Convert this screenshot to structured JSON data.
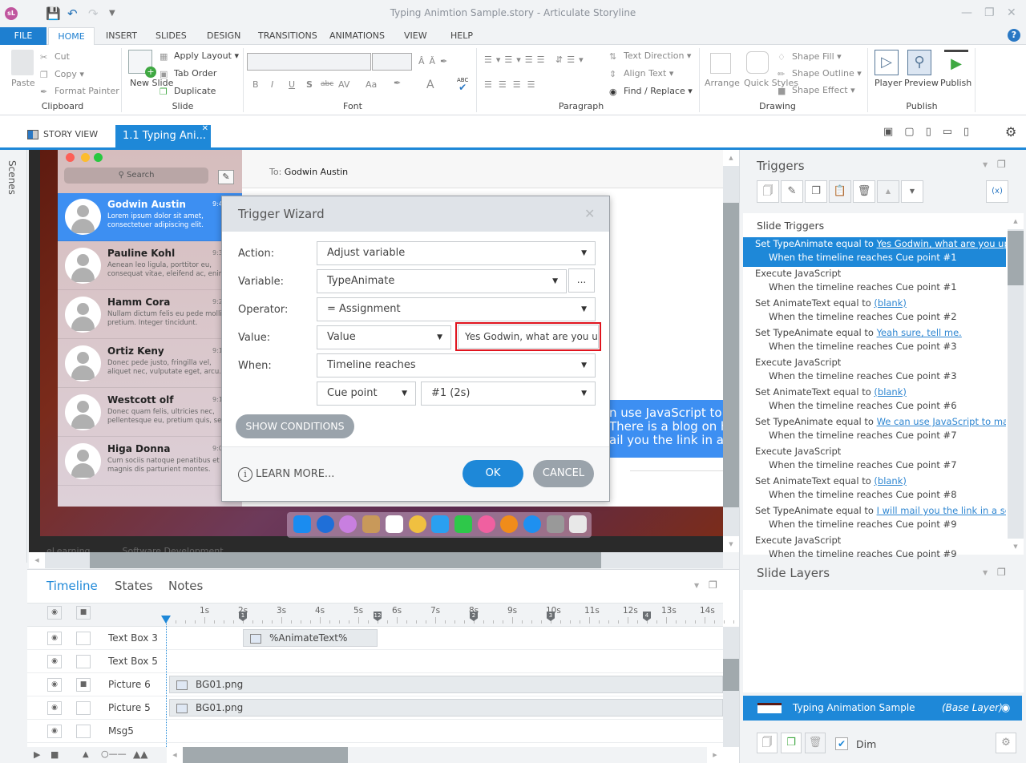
{
  "app": {
    "title": "Typing Animtion Sample.story - Articulate Storyline",
    "logo": "sL"
  },
  "menu": {
    "file": "FILE",
    "tabs": [
      "HOME",
      "INSERT",
      "SLIDES",
      "DESIGN",
      "TRANSITIONS",
      "ANIMATIONS",
      "VIEW",
      "HELP"
    ],
    "active": "HOME"
  },
  "ribbon": {
    "clipboard": {
      "label": "Clipboard",
      "paste": "Paste",
      "cut": "Cut",
      "copy": "Copy",
      "format_painter": "Format Painter"
    },
    "slide": {
      "label": "Slide",
      "new_slide": "New Slide",
      "apply_layout": "Apply Layout",
      "tab_order": "Tab Order",
      "duplicate": "Duplicate"
    },
    "font": {
      "label": "Font",
      "bold": "B",
      "italic": "I",
      "underline": "U",
      "shadow": "S",
      "strike": "abc",
      "spacing": "AV",
      "case": "Aa",
      "color": "A",
      "spell": "ABC"
    },
    "paragraph": {
      "label": "Paragraph",
      "text_direction": "Text Direction",
      "align_text": "Align Text",
      "find_replace": "Find / Replace"
    },
    "drawing": {
      "label": "Drawing",
      "arrange": "Arrange",
      "quick_styles": "Quick Styles",
      "shape_fill": "Shape Fill",
      "shape_outline": "Shape Outline",
      "shape_effect": "Shape Effect"
    },
    "publish": {
      "label": "Publish",
      "player": "Player",
      "preview": "Preview",
      "publish": "Publish"
    }
  },
  "tabs": {
    "story_view": "STORY VIEW",
    "slide_tab": "1.1 Typing Ani..."
  },
  "scenes": "Scenes",
  "slide": {
    "search": "Search",
    "to_label": "To:",
    "to_name": "Godwin Austin",
    "contacts": [
      {
        "name": "Godwin Austin",
        "preview": "Lorem ipsum dolor sit amet, consectetuer adipiscing elit.",
        "time": "9:4"
      },
      {
        "name": "Pauline Kohl",
        "preview": "Aenean leo ligula, porttitor eu, consequat vitae, eleifend ac, enim.",
        "time": "9:3"
      },
      {
        "name": "Hamm Cora",
        "preview": "Nullam dictum felis eu pede mollis pretium. Integer tincidunt.",
        "time": "9:2"
      },
      {
        "name": "Ortiz Keny",
        "preview": "Donec pede justo, fringilla vel, aliquet nec, vulputate eget, arcu.",
        "time": "9:1"
      },
      {
        "name": "Westcott olf",
        "preview": "Donec quam felis, ultricies nec, pellentesque eu, pretium quis, sem.",
        "time": "9:1"
      },
      {
        "name": "Higa Donna",
        "preview": "Cum sociis natoque penatibus et magnis dis parturient montes.",
        "time": "9:0"
      }
    ],
    "bubble_lines": [
      "n use JavaScript to m",
      "There is a blog on h",
      "ail you the link in a s"
    ],
    "footer_text": [
      "eLearning",
      "Software Development"
    ]
  },
  "dialog": {
    "title": "Trigger Wizard",
    "action_label": "Action:",
    "action": "Adjust variable",
    "variable_label": "Variable:",
    "variable": "TypeAnimate",
    "more": "...",
    "operator_label": "Operator:",
    "operator": "= Assignment",
    "value_label": "Value:",
    "value_type": "Value",
    "value_text": "Yes Godwin, what are you upto?",
    "when_label": "When:",
    "when": "Timeline reaches",
    "cue_type": "Cue point",
    "cue": "#1 (2s)",
    "show_conditions": "SHOW CONDITIONS",
    "learn_more": "LEARN MORE...",
    "ok": "OK",
    "cancel": "CANCEL"
  },
  "triggers": {
    "title": "Triggers",
    "section": "Slide Triggers",
    "items": [
      {
        "action": "Set TypeAnimate equal to ",
        "link": "Yes Godwin, what are you upto?",
        "when": "When the timeline reaches Cue point #1",
        "selected": true
      },
      {
        "action": "Execute JavaScript",
        "link": "",
        "when": "When the timeline reaches Cue point #1"
      },
      {
        "action": "Set AnimateText equal to ",
        "link": "(blank)",
        "when": "When the timeline reaches Cue point #2"
      },
      {
        "action": "Set TypeAnimate equal to ",
        "link": "Yeah sure, tell me.",
        "when": "When the timeline reaches Cue point #3"
      },
      {
        "action": "Execute JavaScript",
        "link": "",
        "when": "When the timeline reaches Cue point #3"
      },
      {
        "action": "Set AnimateText equal to ",
        "link": "(blank)",
        "when": "When the timeline reaches Cue point #6"
      },
      {
        "action": "Set TypeAnimate equal to ",
        "link": "We can use JavaScript to make it t",
        "when": "When the timeline reaches Cue point #7"
      },
      {
        "action": "Execute JavaScript",
        "link": "",
        "when": "When the timeline reaches Cue point #7"
      },
      {
        "action": "Set AnimateText equal to ",
        "link": "(blank)",
        "when": "When the timeline reaches Cue point #8"
      },
      {
        "action": "Set TypeAnimate equal to ",
        "link": "I will mail you the link in a second",
        "when": "When the timeline reaches Cue point #9"
      },
      {
        "action": "Execute JavaScript",
        "link": "",
        "when": "When the timeline reaches Cue point #9"
      }
    ]
  },
  "layers": {
    "title": "Slide Layers",
    "base_name": "Typing Animation Sample",
    "base_tag": "(Base Layer)",
    "dim": "Dim",
    "dim_checked": true
  },
  "timeline": {
    "tabs": [
      "Timeline",
      "States",
      "Notes"
    ],
    "active": "Timeline",
    "ticks": [
      "1s",
      "2s",
      "3s",
      "4s",
      "5s",
      "6s",
      "7s",
      "8s",
      "9s",
      "10s",
      "11s",
      "12s",
      "13s",
      "14s"
    ],
    "cues": [
      {
        "label": "1",
        "t": 2
      },
      {
        "label": "12",
        "t": 5.5
      },
      {
        "label": "2",
        "t": 8
      },
      {
        "label": "3",
        "t": 10
      },
      {
        "label": "4",
        "t": 12.5
      }
    ],
    "rows": [
      {
        "name": "Text Box 3",
        "locked": false,
        "bar": "%AnimateText%",
        "start": 2,
        "end": 5.5
      },
      {
        "name": "Text Box 5",
        "locked": false,
        "bar": ""
      },
      {
        "name": "Picture 6",
        "locked": true,
        "bar": "BG01.png",
        "start": 0,
        "end": 15
      },
      {
        "name": "Picture 5",
        "locked": false,
        "bar": "BG01.png",
        "start": 0,
        "end": 15
      },
      {
        "name": "Msg5",
        "locked": false,
        "bar": ""
      }
    ]
  }
}
